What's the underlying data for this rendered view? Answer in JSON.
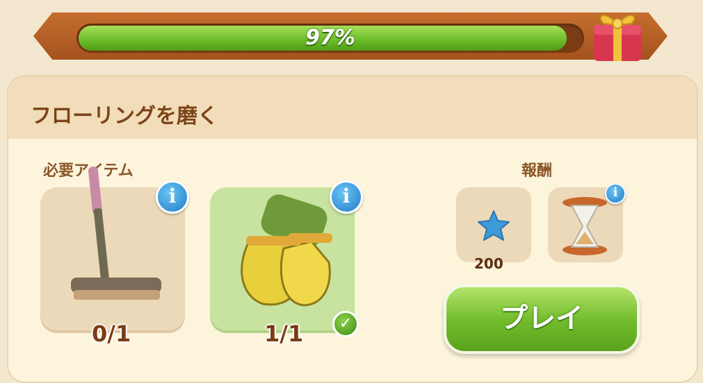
{
  "progress": {
    "label": "97%",
    "value": 0.97
  },
  "task": {
    "title": "フローリングを磨く"
  },
  "required": {
    "label": "必要アイテム",
    "items": [
      {
        "name": "broom",
        "count": "0/1",
        "complete": false
      },
      {
        "name": "gloves",
        "count": "1/1",
        "complete": true
      }
    ]
  },
  "reward": {
    "label": "報酬",
    "items": [
      {
        "name": "star",
        "amount": "200"
      },
      {
        "name": "hourglass"
      }
    ]
  },
  "play_button": {
    "label": "プレイ"
  },
  "icons": {
    "info": "i",
    "check": "✓"
  },
  "colors": {
    "accent_green": "#74bd2e",
    "frame_brown": "#a5521d",
    "info_blue": "#1f7dc7"
  }
}
